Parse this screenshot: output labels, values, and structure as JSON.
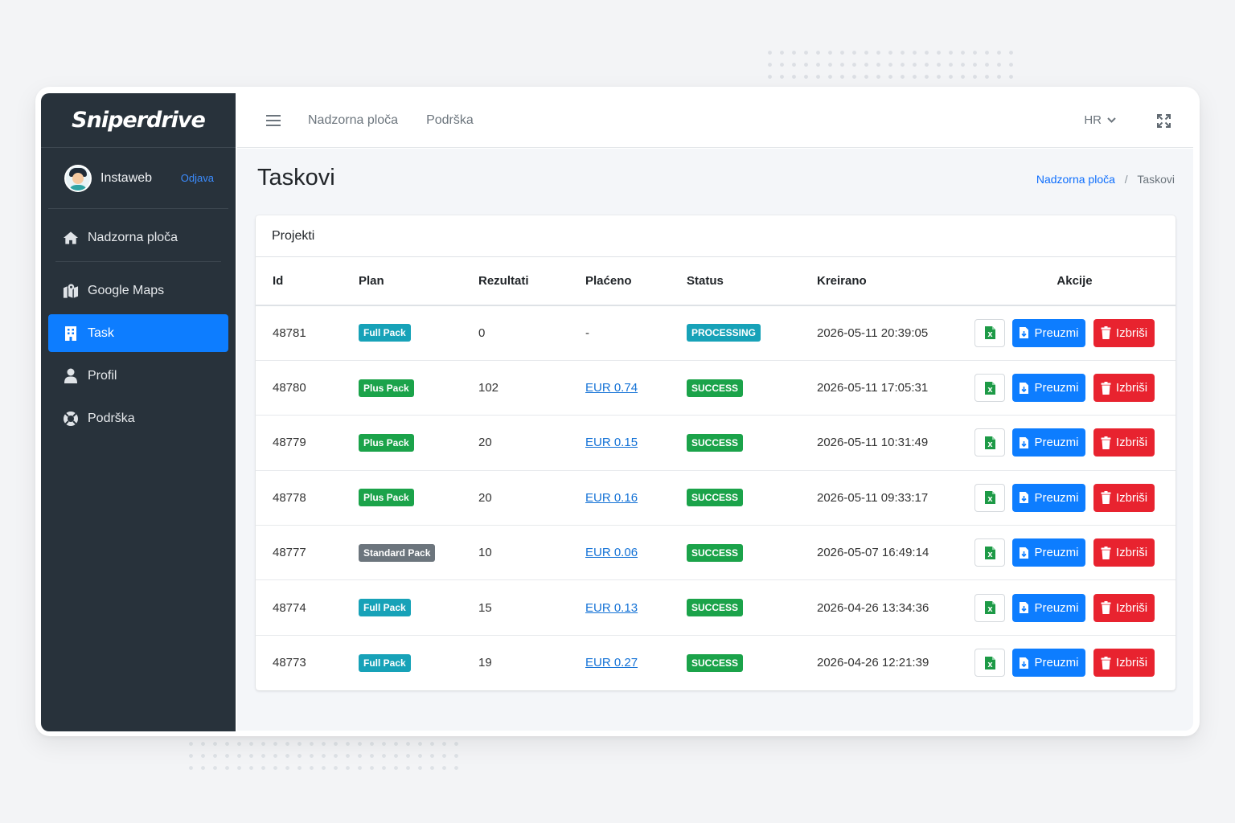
{
  "brand": {
    "name": "Sniperdrive"
  },
  "user": {
    "name": "Instaweb",
    "logout_label": "Odjava"
  },
  "sidebar": {
    "items": [
      {
        "label": "Nadzorna ploča",
        "icon": "home-icon"
      },
      {
        "label": "Google Maps",
        "icon": "map-icon"
      },
      {
        "label": "Task",
        "icon": "building-icon",
        "active": true
      },
      {
        "label": "Profil",
        "icon": "user-icon"
      },
      {
        "label": "Podrška",
        "icon": "lifebuoy-icon"
      }
    ]
  },
  "topbar": {
    "links": [
      "Nadzorna ploča",
      "Podrška"
    ],
    "language": "HR"
  },
  "page": {
    "title": "Taskovi",
    "breadcrumb": {
      "home": "Nadzorna ploča",
      "separator": "/",
      "current": "Taskovi"
    }
  },
  "card": {
    "title": "Projekti",
    "columns": [
      "Id",
      "Plan",
      "Rezultati",
      "Plaćeno",
      "Status",
      "Kreirano",
      "Akcije"
    ],
    "download_label": "Preuzmi",
    "delete_label": "Izbriši",
    "rows": [
      {
        "id": "48781",
        "plan": "Full Pack",
        "results": "0",
        "paid": "-",
        "status": "PROCESSING",
        "created": "2026-05-11 20:39:05"
      },
      {
        "id": "48780",
        "plan": "Plus Pack",
        "results": "102",
        "paid": "EUR 0.74",
        "status": "SUCCESS",
        "created": "2026-05-11 17:05:31"
      },
      {
        "id": "48779",
        "plan": "Plus Pack",
        "results": "20",
        "paid": "EUR 0.15",
        "status": "SUCCESS",
        "created": "2026-05-11 10:31:49"
      },
      {
        "id": "48778",
        "plan": "Plus Pack",
        "results": "20",
        "paid": "EUR 0.16",
        "status": "SUCCESS",
        "created": "2026-05-11 09:33:17"
      },
      {
        "id": "48777",
        "plan": "Standard Pack",
        "results": "10",
        "paid": "EUR 0.06",
        "status": "SUCCESS",
        "created": "2026-05-07 16:49:14"
      },
      {
        "id": "48774",
        "plan": "Full Pack",
        "results": "15",
        "paid": "EUR 0.13",
        "status": "SUCCESS",
        "created": "2026-04-26 13:34:36"
      },
      {
        "id": "48773",
        "plan": "Full Pack",
        "results": "19",
        "paid": "EUR 0.27",
        "status": "SUCCESS",
        "created": "2026-04-26 12:21:39"
      }
    ]
  },
  "colors": {
    "sidebar_bg": "#28323b",
    "primary": "#0d7dff",
    "danger": "#e8232f",
    "plan_full": "#17a2b8",
    "plan_plus": "#1ba34a",
    "plan_standard": "#6c757d",
    "status_processing": "#17a2b8",
    "status_success": "#1ba34a"
  }
}
